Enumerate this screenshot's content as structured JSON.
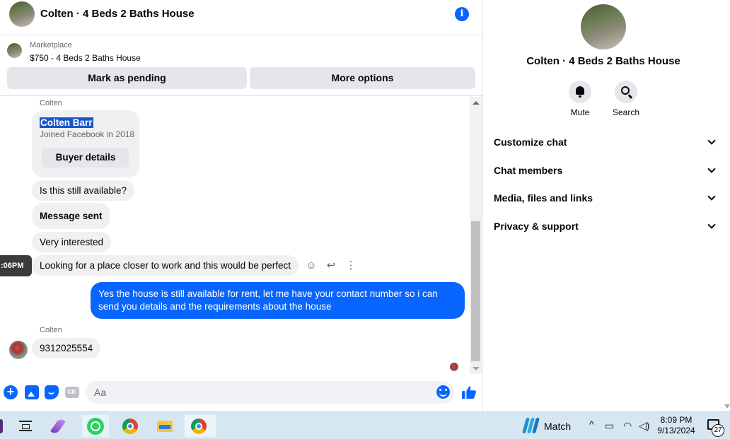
{
  "header": {
    "title": "Colten · 4 Beds 2 Baths House",
    "info_icon": "i"
  },
  "listing": {
    "label": "Marketplace",
    "price_title": "$750 - 4 Beds 2 Baths House",
    "mark_pending_label": "Mark as pending",
    "more_options_label": "More options"
  },
  "messages": {
    "sender_1": "Colten",
    "card": {
      "name": "Colten Barr",
      "joined": "Joined Facebook in 2018",
      "button": "Buyer details"
    },
    "m1": "Is this still available?",
    "m2": "Message sent",
    "m3": "Very interested",
    "m4": "Looking for a place closer to work and this would be perfect",
    "timestamp": ":06PM",
    "out1": "Yes the house is still available for rent, let me have your contact number so i can send you details and the requirements about the house",
    "sender_2": "Colten",
    "m5": "9312025554"
  },
  "composer": {
    "placeholder": "Aa",
    "gif_label": "GIF",
    "plus_label": "+"
  },
  "details": {
    "title": "Colten · 4 Beds 2 Baths House",
    "mute_label": "Mute",
    "search_label": "Search",
    "rows": [
      "Customize chat",
      "Chat members",
      "Media, files and links",
      "Privacy & support"
    ]
  },
  "taskbar": {
    "weather_label": "Match",
    "time": "8:09 PM",
    "date": "9/13/2024",
    "notification_count": "27",
    "tray_chevron": "^"
  },
  "colors": {
    "messenger_blue": "#0866ff",
    "bubble_gray": "#f0f0f0",
    "button_gray": "#e4e6eb"
  }
}
